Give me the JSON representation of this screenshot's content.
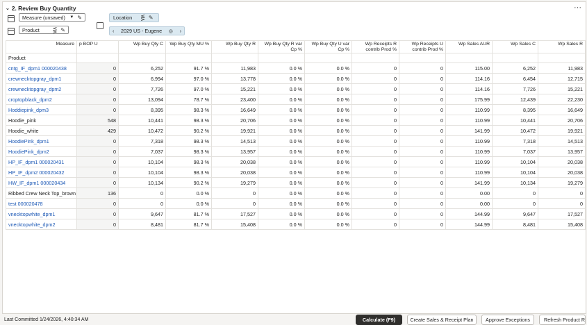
{
  "section": {
    "title": "2. Review Buy Quantity"
  },
  "toolbar": {
    "measure_select": "Measure (unsaved)",
    "product_label": "Product",
    "location_label": "Location",
    "location_nav": "2029 US - Eugene"
  },
  "grid": {
    "measure_label": "Measure",
    "product_label": "Product",
    "columns": [
      "p BOP U",
      "Wp Buy Qty C",
      "Wp Buy Qty MU %",
      "Wp Buy Qty R",
      "Wp Buy Qty R var Cp %",
      "Wp Buy Qty U var Cp %",
      "Wp Receipts R contrib Prod %",
      "Wp Receipts U contrib Prod %",
      "Wp Sales AUR",
      "Wp Sales C",
      "Wp Sales R"
    ],
    "rows": [
      {
        "name": "cntg_IF_dpm1 000020438",
        "link": true,
        "values": [
          "0",
          "6,252",
          "91.7 %",
          "11,983",
          "0.0 %",
          "0.0 %",
          "0",
          "0",
          "115.00",
          "6,252",
          "11,983"
        ]
      },
      {
        "name": "crewnecktopgray_dpm1",
        "link": true,
        "values": [
          "0",
          "6,994",
          "97.0 %",
          "13,778",
          "0.0 %",
          "0.0 %",
          "0",
          "0",
          "114.16",
          "6,454",
          "12,715"
        ]
      },
      {
        "name": "crewnecktopgray_dpm2",
        "link": true,
        "values": [
          "0",
          "7,726",
          "97.0 %",
          "15,221",
          "0.0 %",
          "0.0 %",
          "0",
          "0",
          "114.16",
          "7,726",
          "15,221"
        ]
      },
      {
        "name": "croptopblack_dpm2",
        "link": true,
        "values": [
          "0",
          "13,094",
          "78.7 %",
          "23,400",
          "0.0 %",
          "0.0 %",
          "0",
          "0",
          "175.99",
          "12,439",
          "22,230"
        ]
      },
      {
        "name": "Hoddiepink_dpm3",
        "link": true,
        "values": [
          "0",
          "8,395",
          "98.3 %",
          "16,649",
          "0.0 %",
          "0.0 %",
          "0",
          "0",
          "110.99",
          "8,395",
          "16,649"
        ]
      },
      {
        "name": "Hoodie_pink",
        "link": false,
        "values": [
          "548",
          "10,441",
          "98.3 %",
          "20,706",
          "0.0 %",
          "0.0 %",
          "0",
          "0",
          "110.99",
          "10,441",
          "20,706"
        ]
      },
      {
        "name": "Hoodie_white",
        "link": false,
        "values": [
          "429",
          "10,472",
          "90.2 %",
          "19,921",
          "0.0 %",
          "0.0 %",
          "0",
          "0",
          "141.99",
          "10,472",
          "19,921"
        ]
      },
      {
        "name": "HoodiePink_dpm1",
        "link": true,
        "values": [
          "0",
          "7,318",
          "98.3 %",
          "14,513",
          "0.0 %",
          "0.0 %",
          "0",
          "0",
          "110.99",
          "7,318",
          "14,513"
        ]
      },
      {
        "name": "HoodiePink_dpm2",
        "link": true,
        "values": [
          "0",
          "7,037",
          "98.3 %",
          "13,957",
          "0.0 %",
          "0.0 %",
          "0",
          "0",
          "110.99",
          "7,037",
          "13,957"
        ]
      },
      {
        "name": "HP_IF_dpm1 000020431",
        "link": true,
        "values": [
          "0",
          "10,104",
          "98.3 %",
          "20,038",
          "0.0 %",
          "0.0 %",
          "0",
          "0",
          "110.99",
          "10,104",
          "20,038"
        ]
      },
      {
        "name": "HP_IF_dpm2 000020432",
        "link": true,
        "values": [
          "0",
          "10,104",
          "98.3 %",
          "20,038",
          "0.0 %",
          "0.0 %",
          "0",
          "0",
          "110.99",
          "10,104",
          "20,038"
        ]
      },
      {
        "name": "HW_IF_dpm1 000020434",
        "link": true,
        "values": [
          "0",
          "10,134",
          "90.2 %",
          "19,279",
          "0.0 %",
          "0.0 %",
          "0",
          "0",
          "141.99",
          "10,134",
          "19,279"
        ]
      },
      {
        "name": "Ribbed Crew Neck Top_brown",
        "link": false,
        "values": [
          "136",
          "0",
          "0.0 %",
          "0",
          "0.0 %",
          "0.0 %",
          "0",
          "0",
          "0.00",
          "0",
          "0"
        ]
      },
      {
        "name": "test 000020478",
        "link": true,
        "values": [
          "0",
          "0",
          "0.0 %",
          "0",
          "0.0 %",
          "0.0 %",
          "0",
          "0",
          "0.00",
          "0",
          "0"
        ]
      },
      {
        "name": "vnecktopwhite_dpm1",
        "link": true,
        "values": [
          "0",
          "9,647",
          "81.7 %",
          "17,527",
          "0.0 %",
          "0.0 %",
          "0",
          "0",
          "144.99",
          "9,647",
          "17,527"
        ]
      },
      {
        "name": "vnecktopwhite_dpm2",
        "link": true,
        "values": [
          "0",
          "8,481",
          "81.7 %",
          "15,408",
          "0.0 %",
          "0.0 %",
          "0",
          "0",
          "144.99",
          "8,481",
          "15,408"
        ]
      }
    ]
  },
  "footer": {
    "status": "Last Committed 1/24/2026, 4:40:34 AM",
    "calculate": "Calculate (F9)",
    "create_plan": "Create Sales & Receipt Plan",
    "approve": "Approve Exceptions",
    "refresh": "Refresh Product Ro"
  },
  "icons": {
    "collapse": "chevron-down-icon",
    "more": "ellipsis-icon",
    "hierarchy": "hierarchy-icon",
    "edit": "pencil-icon",
    "target": "target-icon"
  },
  "colors": {
    "link": "#1a57b5",
    "primary_button": "#2f2e2c",
    "location_chip": "#dbe9f1"
  }
}
